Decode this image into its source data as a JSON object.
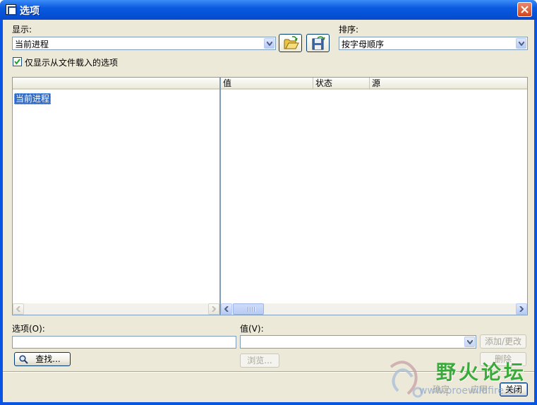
{
  "window": {
    "title": "选项"
  },
  "display": {
    "label": "显示:",
    "value": "当前进程"
  },
  "sort": {
    "label": "排序:",
    "value": "按字母顺序"
  },
  "filter": {
    "checked": true,
    "label": "仅显示从文件载入的选项"
  },
  "tree": {
    "items": [
      "当前进程"
    ]
  },
  "columns": [
    "值",
    "状态",
    "源"
  ],
  "option_field": {
    "label": "选项(O):",
    "value": ""
  },
  "value_field": {
    "label": "值(V):",
    "value": ""
  },
  "buttons": {
    "find": "查找...",
    "browse": "浏览...",
    "add_change": "添加/更改",
    "delete": "删除",
    "ok": "确定",
    "apply": "应用",
    "close": "关闭"
  },
  "watermark": {
    "text": "野火论坛",
    "url": "www.proewildfire.cn"
  },
  "colors": {
    "title_blue": "#0a54e3",
    "selection": "#316ac5",
    "dialog_bg": "#ece9d8",
    "watermark_green": "#3aaa3a"
  }
}
